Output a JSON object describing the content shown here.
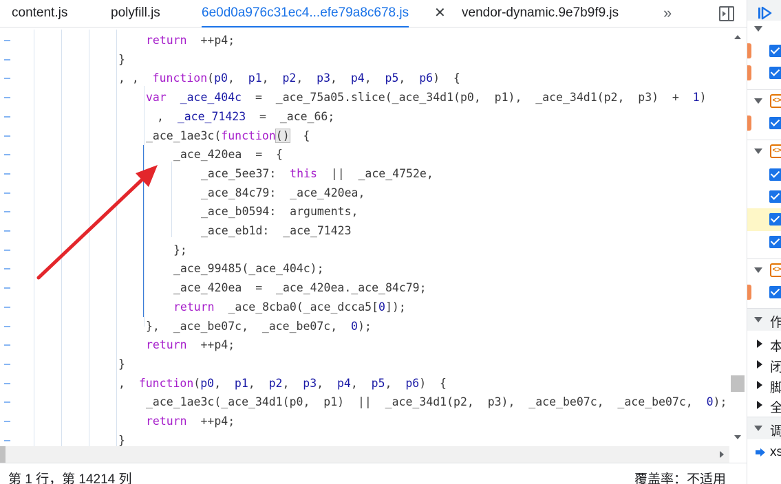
{
  "tabs": [
    {
      "label": "content.js",
      "active": false
    },
    {
      "label": "polyfill.js",
      "active": false
    },
    {
      "label": "6e0d0a976c31ec4...efe79a8c678.js",
      "active": true
    },
    {
      "label": "vendor-dynamic.9e7b9f9.js",
      "active": false
    }
  ],
  "tab_close_symbol": "✕",
  "more_tabs_symbol": "»",
  "gutter_mark": "–",
  "code_lines": [
    {
      "indent": 212,
      "parts": [
        [
          "kw",
          "return"
        ],
        [
          "",
          "  ++p4;"
        ]
      ]
    },
    {
      "indent": 172,
      "parts": [
        [
          "",
          "}"
        ]
      ]
    },
    {
      "indent": 172,
      "parts": [
        [
          "",
          ", ,  "
        ],
        [
          "kw",
          "function"
        ],
        [
          "",
          "("
        ],
        [
          "str",
          "p0"
        ],
        [
          "",
          ",  "
        ],
        [
          "str",
          "p1"
        ],
        [
          "",
          ",  "
        ],
        [
          "str",
          "p2"
        ],
        [
          "",
          ",  "
        ],
        [
          "str",
          "p3"
        ],
        [
          "",
          ",  "
        ],
        [
          "str",
          "p4"
        ],
        [
          "",
          ",  "
        ],
        [
          "str",
          "p5"
        ],
        [
          "",
          ",  "
        ],
        [
          "str",
          "p6"
        ],
        [
          "",
          ")  {"
        ]
      ]
    },
    {
      "indent": 212,
      "parts": [
        [
          "kw",
          "var"
        ],
        [
          "",
          "  "
        ],
        [
          "str",
          "_ace_404c"
        ],
        [
          "",
          "  =  _ace_75a05.slice(_ace_34d1(p0,  p1),  _ace_34d1(p2,  p3)  +  "
        ],
        [
          "num",
          "1"
        ],
        [
          "",
          ")"
        ]
      ]
    },
    {
      "indent": 228,
      "parts": [
        [
          "",
          ",  "
        ],
        [
          "str",
          "_ace_71423"
        ],
        [
          "",
          "  =  _ace_66;"
        ]
      ]
    },
    {
      "indent": 212,
      "parts": [
        [
          "",
          "_ace_1ae3c("
        ],
        [
          "kw",
          "function"
        ],
        [
          "paren",
          "()"
        ],
        [
          "",
          "  {"
        ]
      ]
    },
    {
      "indent": 252,
      "parts": [
        [
          "",
          "_ace_420ea  =  {"
        ]
      ]
    },
    {
      "indent": 292,
      "parts": [
        [
          "",
          "_ace_5ee37:  "
        ],
        [
          "kw",
          "this"
        ],
        [
          "",
          "  ||  _ace_4752e,"
        ]
      ]
    },
    {
      "indent": 292,
      "parts": [
        [
          "",
          "_ace_84c79:  _ace_420ea,"
        ]
      ]
    },
    {
      "indent": 292,
      "parts": [
        [
          "",
          "_ace_b0594:  arguments,"
        ]
      ]
    },
    {
      "indent": 292,
      "parts": [
        [
          "",
          "_ace_eb1d:  _ace_71423"
        ]
      ]
    },
    {
      "indent": 252,
      "parts": [
        [
          "",
          "};"
        ]
      ]
    },
    {
      "indent": 252,
      "parts": [
        [
          "",
          "_ace_99485(_ace_404c);"
        ]
      ]
    },
    {
      "indent": 252,
      "parts": [
        [
          "",
          "_ace_420ea  =  _ace_420ea._ace_84c79;"
        ]
      ]
    },
    {
      "indent": 252,
      "parts": [
        [
          "kw",
          "return"
        ],
        [
          "",
          "  _ace_8cba0(_ace_dcca5["
        ],
        [
          "num",
          "0"
        ],
        [
          "",
          "]);"
        ]
      ]
    },
    {
      "indent": 212,
      "parts": [
        [
          "",
          "},  _ace_be07c,  _ace_be07c,  "
        ],
        [
          "num",
          "0"
        ],
        [
          "",
          ");"
        ]
      ]
    },
    {
      "indent": 212,
      "parts": [
        [
          "kw",
          "return"
        ],
        [
          "",
          "  ++p4;"
        ]
      ]
    },
    {
      "indent": 172,
      "parts": [
        [
          "",
          "}"
        ]
      ]
    },
    {
      "indent": 172,
      "parts": [
        [
          "",
          ",  "
        ],
        [
          "kw",
          "function"
        ],
        [
          "",
          "("
        ],
        [
          "str",
          "p0"
        ],
        [
          "",
          ",  "
        ],
        [
          "str",
          "p1"
        ],
        [
          "",
          ",  "
        ],
        [
          "str",
          "p2"
        ],
        [
          "",
          ",  "
        ],
        [
          "str",
          "p3"
        ],
        [
          "",
          ",  "
        ],
        [
          "str",
          "p4"
        ],
        [
          "",
          ",  "
        ],
        [
          "str",
          "p5"
        ],
        [
          "",
          ",  "
        ],
        [
          "str",
          "p6"
        ],
        [
          "",
          ")  {"
        ]
      ]
    },
    {
      "indent": 212,
      "parts": [
        [
          "",
          "_ace_1ae3c(_ace_34d1(p0,  p1)  ||  _ace_34d1(p2,  p3),  _ace_be07c,  _ace_be07c,  "
        ],
        [
          "num",
          "0"
        ],
        [
          "",
          ");"
        ]
      ]
    },
    {
      "indent": 212,
      "parts": [
        [
          "kw",
          "return"
        ],
        [
          "",
          "  ++p4;"
        ]
      ]
    },
    {
      "indent": 172,
      "parts": [
        [
          "",
          "}"
        ]
      ]
    }
  ],
  "status": {
    "position": "第 1 行，第 14214 列",
    "coverage": "覆盖率：不适用"
  },
  "sidebar": {
    "section_title": "作",
    "pane_items": [
      "本",
      "闭",
      "脚",
      "全"
    ],
    "callstack_title": "调",
    "callstack_item": "xs"
  },
  "colors": {
    "accent": "#1a73e8",
    "keyword": "#a61ecb",
    "identifier": "#1a1aa6",
    "arrow": "#e3262b",
    "breakpoint": "#f28b54"
  }
}
